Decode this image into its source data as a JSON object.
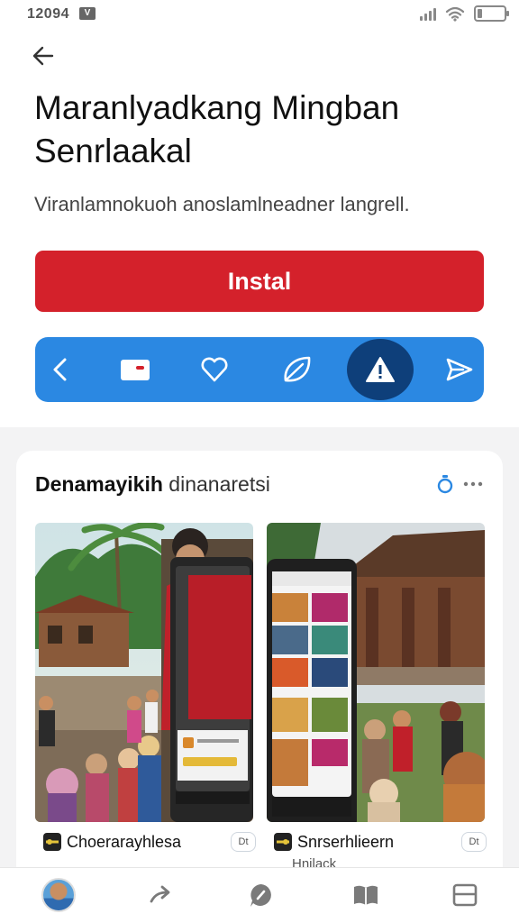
{
  "status": {
    "time": "12094",
    "badge": "V"
  },
  "header": {
    "title": "Maranlyadkang Mingban Senrlaakal",
    "subtitle": "Viranlamnokuoh anoslamlneadner langrell."
  },
  "install": {
    "label": "Instal"
  },
  "share_bar": {
    "icons": [
      "chevron-left-icon",
      "mail-icon",
      "heart-icon",
      "leaf-icon",
      "alert-icon",
      "send-icon"
    ],
    "active_index": 4
  },
  "card": {
    "title_bold": "Denamayikih",
    "title_rest": "dinanaretsi",
    "items": [
      {
        "name": "Choerarayhlesa",
        "tag": "Dt"
      },
      {
        "name": "Snrserhlieern",
        "tag": "Dt",
        "sub": "Hnilack"
      }
    ]
  },
  "colors": {
    "install": "#d4212b",
    "share_bar": "#2b88e2",
    "share_active": "#0e3f7a",
    "accent": "#2b88e2"
  },
  "bottom_nav": {
    "icons": [
      "profile-avatar",
      "forward-icon",
      "chat-icon",
      "book-icon",
      "window-icon"
    ]
  }
}
